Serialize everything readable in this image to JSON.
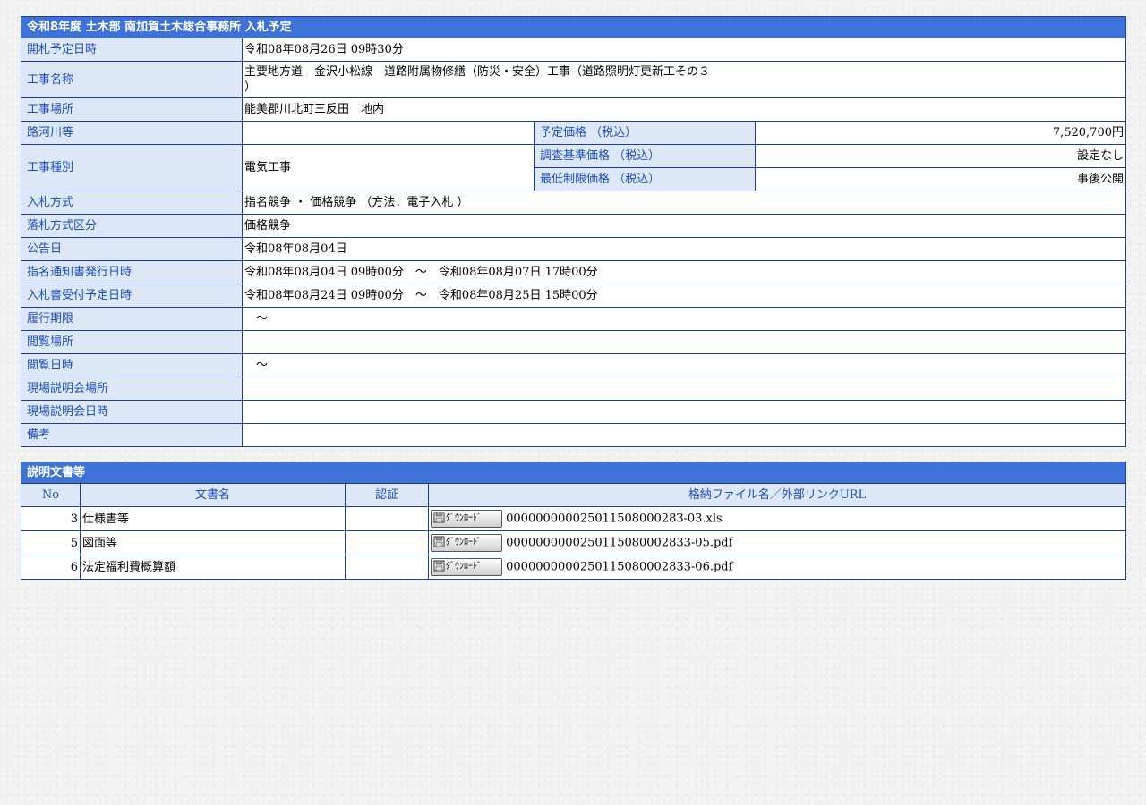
{
  "bid": {
    "title": "令和8年度 土木部 南加賀土木総合事務所 入札予定",
    "rows": {
      "opening_datetime": {
        "label": "開札予定日時",
        "value": "令和08年08月26日 09時30分"
      },
      "work_name": {
        "label": "工事名称",
        "value_line1": "主要地方道　金沢小松線　道路附属物修繕（防災・安全）工事（道路照明灯更新工その３",
        "value_line2": "）"
      },
      "work_place": {
        "label": "工事場所",
        "value": "能美郡川北町三反田　地内"
      },
      "river": {
        "label": "路河川等",
        "value": ""
      },
      "planned_price": {
        "label": "予定価格 （税込）",
        "value": "7,520,700円"
      },
      "work_type": {
        "label": "工事種別",
        "value": "電気工事"
      },
      "survey_price": {
        "label": "調査基準価格 （税込）",
        "value": "設定なし"
      },
      "min_price": {
        "label": "最低制限価格 （税込）",
        "value": "事後公開"
      },
      "bid_method": {
        "label": "入札方式",
        "value": "指名競争 ・ 価格競争 （方法：電子入札 ）"
      },
      "award_type": {
        "label": "落札方式区分",
        "value": "価格競争"
      },
      "notice_date": {
        "label": "公告日",
        "value": "令和08年08月04日"
      },
      "nomination_notice": {
        "label": "指名通知書発行日時",
        "value": "令和08年08月04日 09時00分　～　令和08年08月07日 17時00分"
      },
      "bid_reception": {
        "label": "入札書受付予定日時",
        "value": "令和08年08月24日 09時00分　～　令和08年08月25日 15時00分"
      },
      "performance_period": {
        "label": "履行期限",
        "value": "　～"
      },
      "viewing_place": {
        "label": "閲覧場所",
        "value": ""
      },
      "viewing_datetime": {
        "label": "閲覧日時",
        "value": "　～"
      },
      "briefing_place": {
        "label": "現場説明会場所",
        "value": ""
      },
      "briefing_datetime": {
        "label": "現場説明会日時",
        "value": ""
      },
      "remarks": {
        "label": "備考",
        "value": ""
      }
    }
  },
  "docs": {
    "title": "説明文書等",
    "headers": {
      "no": "No",
      "name": "文書名",
      "cert": "認証",
      "file": "格納ファイル名／外部リンクURL"
    },
    "download_label": "ﾀﾞｳﾝﾛｰﾄﾞ",
    "items": [
      {
        "no": "3",
        "name": "仕様書等",
        "cert": "",
        "file": "00000000002501150800028З-03.xls"
      },
      {
        "no": "5",
        "name": "図面等",
        "cert": "",
        "file": "0000000000250115080002833-05.pdf"
      },
      {
        "no": "6",
        "name": "法定福利費概算額",
        "cert": "",
        "file": "0000000000250115080002833-06.pdf"
      }
    ]
  },
  "colors": {
    "header_bg": "#3f72d6",
    "label_bg": "#dde7f6",
    "label_text": "#1b4fb8",
    "border": "#1f3f8f"
  }
}
